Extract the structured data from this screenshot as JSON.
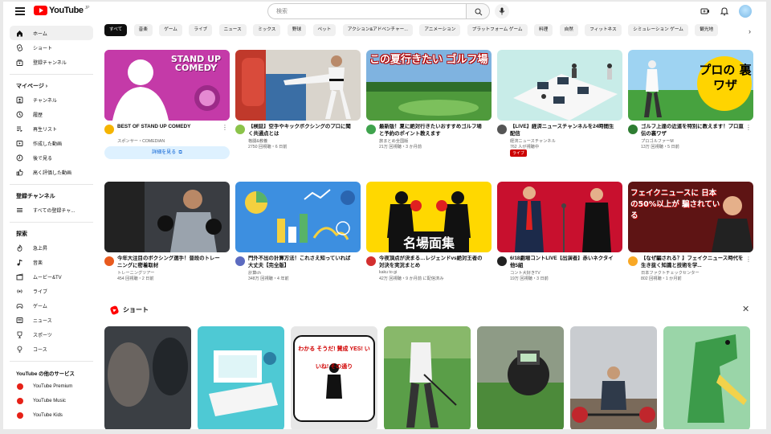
{
  "topbar": {
    "logo_text": "YouTube",
    "logo_sup": "JP",
    "search_placeholder": "検索"
  },
  "sidebar": {
    "main": [
      {
        "label": "ホーム",
        "icon": "home-icon",
        "active": true
      },
      {
        "label": "ショート",
        "icon": "shorts-icon"
      },
      {
        "label": "登録チャンネル",
        "icon": "subscriptions-icon"
      }
    ],
    "you_header": "マイページ ›",
    "you": [
      {
        "label": "チャンネル",
        "icon": "channel-icon"
      },
      {
        "label": "履歴",
        "icon": "history-icon"
      },
      {
        "label": "再生リスト",
        "icon": "playlist-icon"
      },
      {
        "label": "作成した動画",
        "icon": "your-videos-icon"
      },
      {
        "label": "後で見る",
        "icon": "watch-later-icon"
      },
      {
        "label": "高く評価した動画",
        "icon": "liked-icon"
      }
    ],
    "subs_header": "登録チャンネル",
    "subs": [
      {
        "label": "すべての登録チャ...",
        "icon": "list-icon"
      }
    ],
    "explore_header": "探索",
    "explore": [
      {
        "label": "急上昇",
        "icon": "trending-icon"
      },
      {
        "label": "音楽",
        "icon": "music-icon"
      },
      {
        "label": "ムービー&TV",
        "icon": "movie-icon"
      },
      {
        "label": "ライブ",
        "icon": "live-icon"
      },
      {
        "label": "ゲーム",
        "icon": "gaming-icon"
      },
      {
        "label": "ニュース",
        "icon": "news-icon"
      },
      {
        "label": "スポーツ",
        "icon": "sports-icon"
      },
      {
        "label": "コース",
        "icon": "course-icon"
      }
    ],
    "more_header": "YouTube の他のサービス",
    "more": [
      {
        "label": "YouTube Premium",
        "icon": "youtube-premium-icon"
      },
      {
        "label": "YouTube Music",
        "icon": "youtube-music-icon"
      },
      {
        "label": "YouTube Kids",
        "icon": "youtube-kids-icon"
      }
    ]
  },
  "chips": [
    "すべて",
    "音楽",
    "ゲーム",
    "ライブ",
    "ニュース",
    "ミックス",
    "野球",
    "ペット",
    "アクション&アドベンチャー...",
    "アニメーション",
    "プラットフォーム ゲーム",
    "料理",
    "自然",
    "フィットネス",
    "シミュレーション ゲーム",
    "観光地"
  ],
  "videos": [
    {
      "title": "BEST OF STAND UP COMEDY",
      "channel": "スポンサー・COMEDIAN",
      "stats": "",
      "ad_button": "詳細を見る",
      "thumb_text": "STAND UP COMEDY",
      "avatar_color": "#f5b400"
    },
    {
      "title": "【検証】空手やキックボクシングのプロに聞く共通点とは",
      "channel": "格闘&教養",
      "stats": "2750 回視聴・6 日前",
      "avatar_color": "#8bc34a"
    },
    {
      "title": "最新版！夏に絶対行きたいおすすめゴルフ場と予約のポイント教えます",
      "channel": "旅まとめ全国版",
      "stats": "21万 回視聴・3 か月前",
      "thumb_text": "この夏行きたい ゴルフ場",
      "avatar_color": "#3fa34d"
    },
    {
      "title": "【LIVE】経済ニュースチャンネルを24時間生配信",
      "channel": "経済ニュースチャンネル",
      "stats": "762 人が視聴中",
      "live": "ライブ",
      "avatar_color": "#555555"
    },
    {
      "title": "ゴルフ上達の近道を特別に教えます！プロ直伝の裏ワザ",
      "channel": "プロゴルファーM",
      "stats": "13万 回視聴・5 日前",
      "thumb_text": "プロの 裏ワザ",
      "avatar_color": "#2e7d32"
    },
    {
      "title": "今年大注目のボクシング選手！普段のトレーニングに密着取材",
      "channel": "トレーニングツアー",
      "stats": "454 回視聴・2 日前",
      "avatar_color": "#e85a1e"
    },
    {
      "title": "門外不出の計算方法！これさえ知っていれば大丈夫【完全版】",
      "channel": "計算ch",
      "stats": "348万 回視聴・4 年前",
      "avatar_color": "#5c6bc0"
    },
    {
      "title": "今夜頂点が決まる…レジェンドvs絶対王者の対決を実況まとめ",
      "channel": "kaku to gi",
      "stats": "42万 回視聴・9 か月前 に配信済み",
      "thumb_text": "名場面集",
      "avatar_color": "#d32f2f"
    },
    {
      "title": "6/18劇場コントLIVE【出演者】赤いネクタイ他5組",
      "channel": "コント大好きTV",
      "stats": "19万 回視聴・3 日前",
      "avatar_color": "#212121"
    },
    {
      "title": "【なぜ騙される？】フェイクニュース時代を生き抜く知識と技術を学...",
      "channel": "日本ファクトチェックセンター",
      "stats": "802 回視聴・1 か月前",
      "thumb_text": "フェイクニュースに 日本の50%以上が 騙されている",
      "avatar_color": "#f9a825"
    }
  ],
  "shorts": {
    "title": "ショート",
    "items": [
      {
        "label": ""
      },
      {
        "label": ""
      },
      {
        "label": "わかる そうだ! 賛成 YES! いいね! その通り"
      },
      {
        "label": ""
      },
      {
        "label": ""
      },
      {
        "label": ""
      },
      {
        "label": ""
      }
    ]
  },
  "colors": {
    "brand": "#ff0000",
    "chip_active": "#0f0f0f",
    "link": "#065fd4"
  }
}
